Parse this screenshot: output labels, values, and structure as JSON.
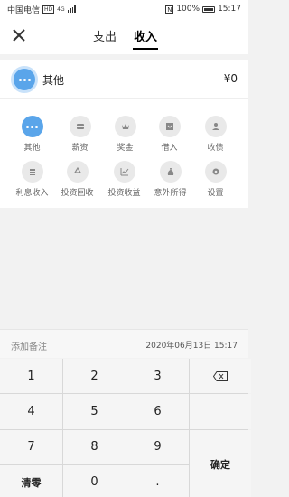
{
  "status": {
    "carrier": "中国电信",
    "hd": "HD",
    "net": "4G",
    "battery": "100%",
    "time": "15:17"
  },
  "tabs": [
    {
      "label": "支出"
    },
    {
      "label": "收入"
    }
  ],
  "selected": {
    "name": "其他",
    "amount": "¥0"
  },
  "categories": [
    {
      "label": "其他",
      "icon": "more-icon"
    },
    {
      "label": "薪资",
      "icon": "card-icon"
    },
    {
      "label": "奖金",
      "icon": "crown-icon"
    },
    {
      "label": "借入",
      "icon": "box-in-icon"
    },
    {
      "label": "收债",
      "icon": "hand-person-icon"
    },
    {
      "label": "利息收入",
      "icon": "coin-stack-icon"
    },
    {
      "label": "投资回收",
      "icon": "recycle-icon"
    },
    {
      "label": "投资收益",
      "icon": "line-chart-icon"
    },
    {
      "label": "意外所得",
      "icon": "money-bag-icon"
    },
    {
      "label": "设置",
      "icon": "gear-icon"
    }
  ],
  "note": {
    "placeholder": "添加备注",
    "date": "2020年06月13日 15:17"
  },
  "keys": {
    "k1": "1",
    "k2": "2",
    "k3": "3",
    "k4": "4",
    "k5": "5",
    "k6": "6",
    "k7": "7",
    "k8": "8",
    "k9": "9",
    "k0": "0",
    "dot": ".",
    "clear": "清零",
    "confirm": "确定"
  },
  "colors": {
    "accent": "#5aa5ea",
    "icon_bg": "#e9e9e9"
  }
}
